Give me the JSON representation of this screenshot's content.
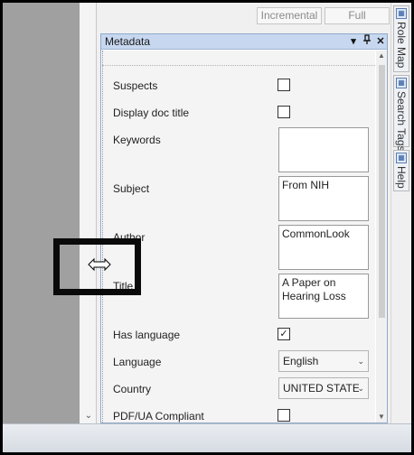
{
  "toolbar": {
    "incremental_label": "Incremental",
    "full_label": "Full"
  },
  "panel": {
    "title": "Metadata",
    "dropdown_icon": "chevron-down-icon",
    "pin_icon": "pin-icon",
    "close_icon": "close-icon"
  },
  "fields": {
    "suspects": {
      "label": "Suspects",
      "checked": false
    },
    "display_doc_title": {
      "label": "Display doc title",
      "checked": false
    },
    "keywords": {
      "label": "Keywords",
      "value": ""
    },
    "subject": {
      "label": "Subject",
      "value": "From NIH"
    },
    "author": {
      "label": "Author",
      "value": "CommonLook"
    },
    "title": {
      "label": "Title",
      "value": "A Paper on\nHearing Loss"
    },
    "has_language": {
      "label": "Has language",
      "checked": true,
      "check_glyph": "✓"
    },
    "language": {
      "label": "Language",
      "value": "English"
    },
    "country": {
      "label": "Country",
      "value": "UNITED STATES"
    },
    "pdfua": {
      "label": "PDF/UA Compliant",
      "checked": false
    }
  },
  "side_tabs": {
    "role_map": "Role Map",
    "search_tags": "Search Tags",
    "help": "Help"
  },
  "colors": {
    "panel_header": "#c6d7ef",
    "highlight_box": "#0a0a0a",
    "left_pane": "#a0a0a0"
  }
}
